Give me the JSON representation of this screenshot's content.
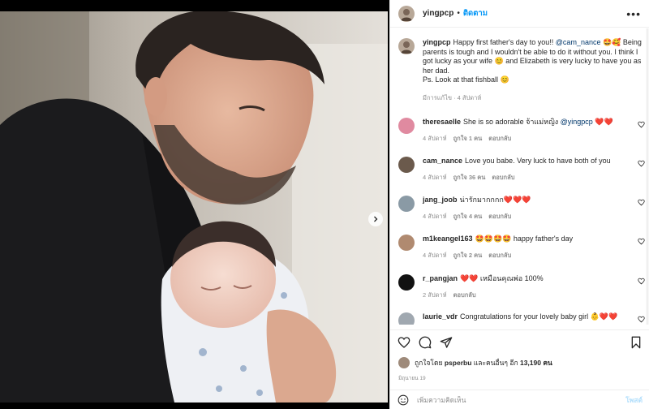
{
  "post": {
    "author": "yingpcp",
    "follow_label": "ติดตาม",
    "separator": "•",
    "more_icon": "more-horizontal-icon",
    "caption": {
      "author": "yingpcp",
      "before_mention": "Happy first father's day to you!! ",
      "mention": "@cam_nance",
      "after_mention": " 🤩🥰 Being parents is tough and I wouldn't be able to do it without you. I think I got lucky as your wife 😊 and Elizabeth is very lucky to have you as her dad.",
      "ps": "Ps. Look at that fishball 😊",
      "meta": "มีการแก้ไข · 4 สัปดาห์"
    },
    "carousel": {
      "current_index": 1,
      "total": 2
    }
  },
  "comments": [
    {
      "user": "theresaelle",
      "text": "She is so adorable จ้าแม่หญิง ",
      "mention": "@yingpcp",
      "suffix": " ❤️❤️",
      "age": "4 สัปดาห์",
      "likes": "ถูกใจ 1 คน",
      "reply": "ตอบกลับ",
      "avatar_color": "#e08aa0"
    },
    {
      "user": "cam_nance",
      "text": "Love you babe. Very luck to have both of you",
      "mention": "",
      "suffix": "",
      "age": "4 สัปดาห์",
      "likes": "ถูกใจ 36 คน",
      "reply": "ตอบกลับ",
      "avatar_color": "#6b5a4c"
    },
    {
      "user": "jang_joob",
      "text": "น่ารักมากกกก",
      "mention": "",
      "suffix": "❤️❤️❤️",
      "age": "4 สัปดาห์",
      "likes": "ถูกใจ 4 คน",
      "reply": "ตอบกลับ",
      "avatar_color": "#8a9aa5"
    },
    {
      "user": "m1keangel163",
      "text": "🤩🤩🤩🤩 happy father's day",
      "mention": "",
      "suffix": "",
      "age": "4 สัปดาห์",
      "likes": "ถูกใจ 2 คน",
      "reply": "ตอบกลับ",
      "avatar_color": "#b08a70"
    },
    {
      "user": "r_pangjan",
      "text": "❤️❤️ เหมือนคุณพ่อ 100%",
      "mention": "",
      "suffix": "",
      "age": "2 สัปดาห์",
      "likes": "",
      "reply": "ตอบกลับ",
      "avatar_color": "#111111"
    },
    {
      "user": "laurie_vdr",
      "text": "Congratulations for your lovely baby girl 👶❤️❤️",
      "mention": "",
      "suffix": "",
      "age": "",
      "likes": "",
      "reply": "",
      "avatar_color": "#a0a8b0"
    }
  ],
  "likes": {
    "prefix": "ถูกใจโดย ",
    "user": "psperbu",
    "middle": " และคนอื่นๆ อีก ",
    "count": "13,190",
    "suffix": " คน"
  },
  "date": "มิถุนายน 19",
  "add_comment": {
    "placeholder": "เพิ่มความคิดเห็น",
    "post_label": "โพสต์"
  },
  "icons": {
    "like": "heart-icon",
    "comment": "comment-icon",
    "share": "paper-plane-icon",
    "save": "bookmark-icon",
    "emoji": "smiley-icon",
    "next": "chevron-right-icon"
  },
  "colors": {
    "accent": "#0095f6",
    "heart_red": "#ed4956",
    "muted": "#8e8e8e"
  }
}
